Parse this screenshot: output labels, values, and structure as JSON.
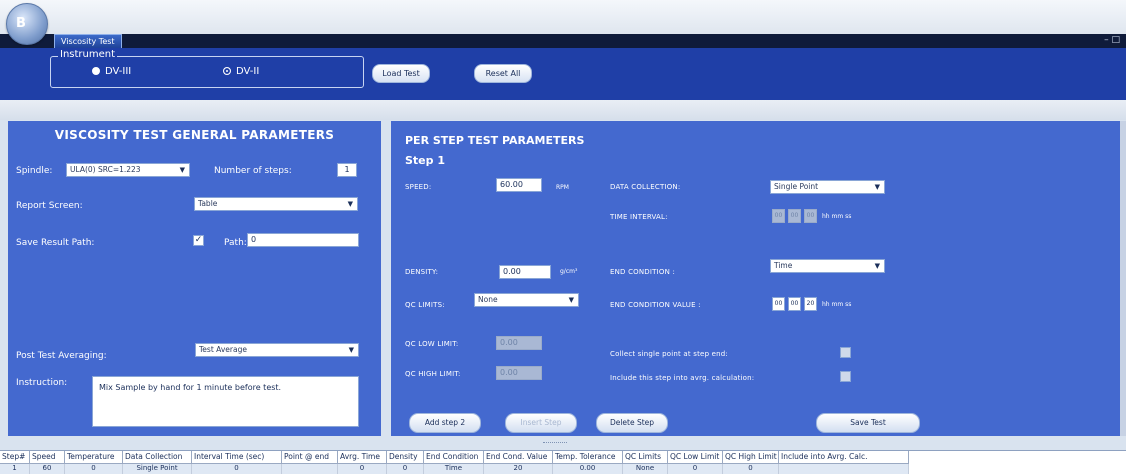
{
  "app": {
    "orb_letter": "B",
    "tab_label": "Viscosity Test",
    "window_controls": "– □"
  },
  "instrument": {
    "legend": "Instrument",
    "options": [
      {
        "label": "DV-III",
        "selected": false
      },
      {
        "label": "DV-II",
        "selected": true
      }
    ]
  },
  "ribbon": {
    "load_test": "Load Test",
    "reset_all": "Reset All"
  },
  "general": {
    "title": "VISCOSITY TEST GENERAL PARAMETERS",
    "spindle_label": "Spindle:",
    "spindle_value": "ULA(0) SRC=1.223",
    "steps_label": "Number of steps:",
    "steps_value": "1",
    "report_label": "Report Screen:",
    "report_value": "Table",
    "save_label": "Save Result Path:",
    "save_checked": "✓",
    "path_label": "Path:",
    "path_value": "0",
    "avg_label": "Post Test Averaging:",
    "avg_value": "Test Average",
    "instruction_label": "Instruction:",
    "instruction_value": "Mix Sample by hand for 1 minute before test."
  },
  "step": {
    "title": "PER STEP TEST PARAMETERS",
    "step_title": "Step 1",
    "speed_label": "SPEED:",
    "speed_value": "60.00",
    "speed_unit": "RPM",
    "dc_label": "DATA COLLECTION:",
    "dc_value": "Single Point",
    "ti_label": "TIME INTERVAL:",
    "ti_h": "00",
    "ti_m": "00",
    "ti_s": "00",
    "ti_unit": "hh mm ss",
    "density_label": "DENSITY:",
    "density_value": "0.00",
    "density_unit": "g/cm³",
    "ec_label": "END CONDITION :",
    "ec_value": "Time",
    "qclim_label": "QC LIMITS:",
    "qclim_value": "None",
    "ecv_label": "END CONDITION VALUE :",
    "ecv_h": "00",
    "ecv_m": "00",
    "ecv_s": "20",
    "ecv_unit": "hh mm ss",
    "qclow_label": "QC LOW LIMIT:",
    "qclow_value": "0.00",
    "qchigh_label": "QC HIGH LIMIT:",
    "qchigh_value": "0.00",
    "collect_label": "Collect single point at step end:",
    "include_label": "Include this step into avrg. calculation:"
  },
  "actions": {
    "add_step": "Add step 2",
    "insert_step": "Insert Step",
    "delete_step": "Delete Step",
    "save_test": "Save Test"
  },
  "grid": {
    "columns": [
      "Step#",
      "Speed",
      "Temperature",
      "Data Collection",
      "Interval Time (sec)",
      "Point @ end",
      "Avrg. Time",
      "Density",
      "End Condition",
      "End Cond. Value",
      "Temp. Tolerance",
      "QC Limits",
      "QC Low Limit",
      "QC High Limit",
      "Include into Avrg. Calc."
    ],
    "row": [
      "1",
      "60",
      "0",
      "Single Point",
      "0",
      "",
      "0",
      "0",
      "Time",
      "20",
      "0.00",
      "None",
      "0",
      "0",
      ""
    ]
  }
}
